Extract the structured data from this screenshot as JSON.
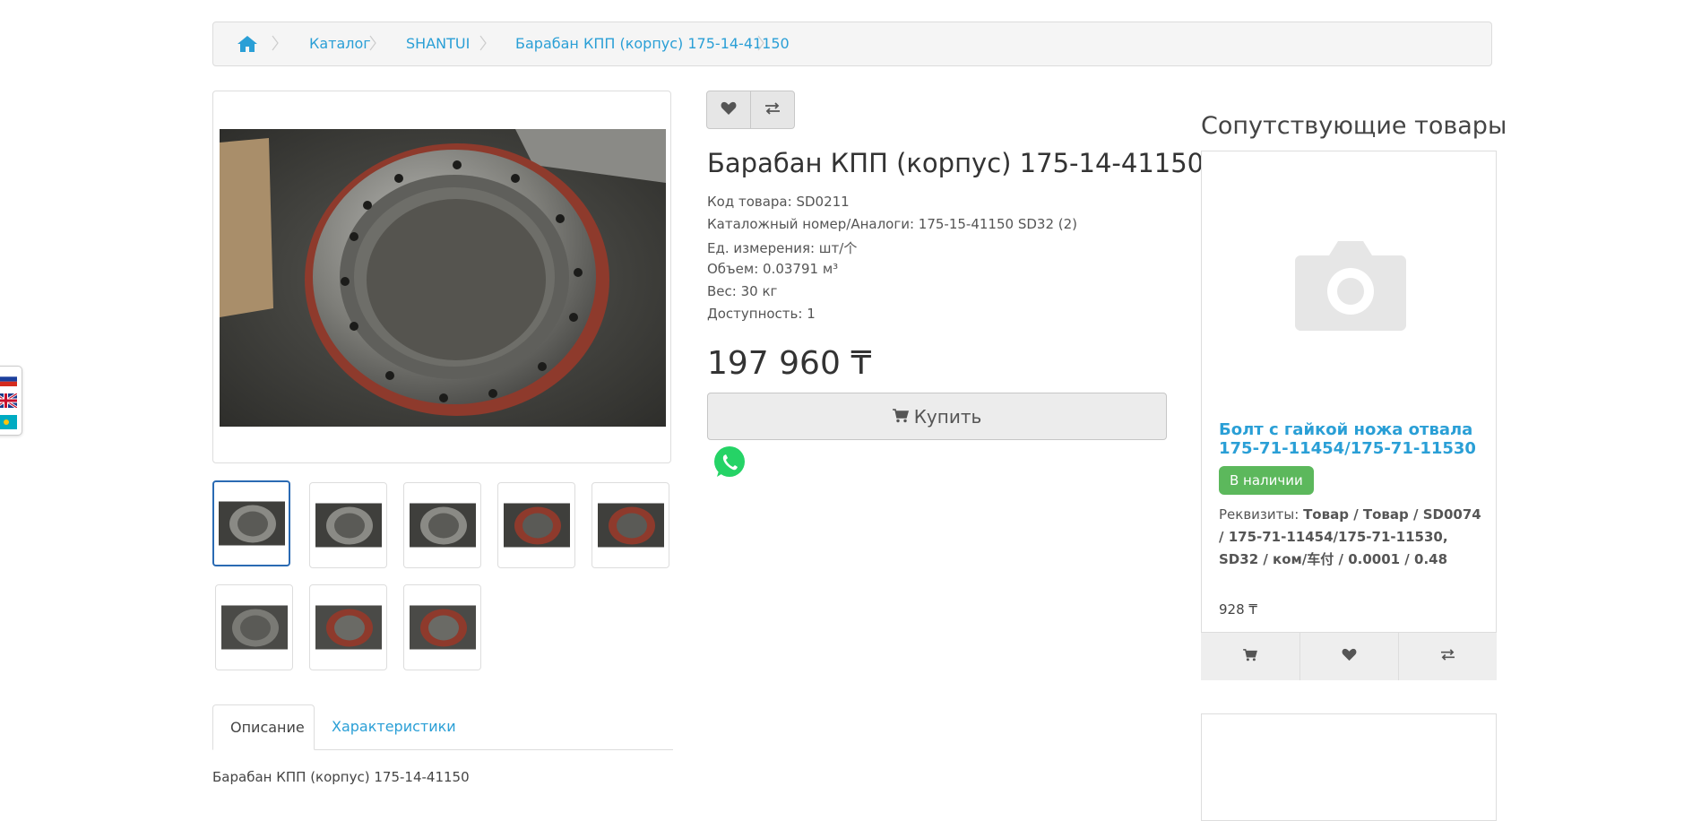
{
  "breadcrumb": {
    "home_icon": "home-icon",
    "items": [
      "Каталог",
      "SHANTUI",
      "Барабан КПП (корпус) 175-14-41150"
    ]
  },
  "language_flags": [
    "flag-ru-icon",
    "flag-gb-icon",
    "flag-kz-icon"
  ],
  "gallery": {
    "main_image_icon": "gear-drum-photo",
    "thumbnails_count": 8,
    "active_index": 0
  },
  "tabs": [
    "Описание",
    "Характеристики"
  ],
  "description": "Барабан КПП (корпус) 175-14-41150",
  "product": {
    "wishlist_icon": "heart-icon",
    "compare_icon": "exchange-icon",
    "title": "Барабан КПП (корпус) 175-14-41150",
    "meta": [
      "Код товара: SD0211",
      "Каталожный номер/Аналоги: 175-15-41150 SD32 (2)",
      "Ед. измерения: шт/个",
      "Объем: 0.03791 м³",
      "Вес: 30 кг",
      "Доступность: 1"
    ],
    "price": "197 960 ₸",
    "buy_label": "Купить",
    "whatsapp_icon": "whatsapp-icon"
  },
  "related": {
    "heading": "Сопутствующие товары",
    "items": [
      {
        "name": "Болт с гайкой ножа отвала 175-71-11454/175-71-11530",
        "availability": "В наличии",
        "requisites_label": "Реквизиты:",
        "requisites_value": "Товар / Товар / SD0074 / 175-71-11454/175-71-11530, SD32 / ком/车付 / 0.0001 / 0.48",
        "price": "928 ₸"
      }
    ]
  },
  "colors": {
    "link": "#2a9fd6",
    "badge_green": "#5cb85c",
    "active_thumb_border": "#2a6ab3"
  }
}
